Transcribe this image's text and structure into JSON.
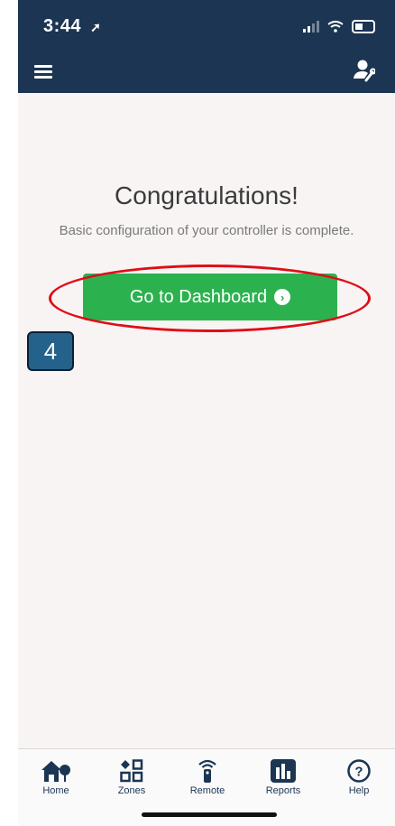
{
  "status_bar": {
    "time": "3:44"
  },
  "content": {
    "title": "Congratulations!",
    "subtitle": "Basic configuration of your controller is complete.",
    "dashboard_button": "Go to Dashboard",
    "step_badge": "4"
  },
  "tabs": [
    {
      "label": "Home",
      "icon": "home-icon"
    },
    {
      "label": "Zones",
      "icon": "zones-icon"
    },
    {
      "label": "Remote",
      "icon": "remote-icon"
    },
    {
      "label": "Reports",
      "icon": "reports-icon"
    },
    {
      "label": "Help",
      "icon": "help-icon"
    }
  ],
  "colors": {
    "header": "#1b3553",
    "button": "#2cb14f",
    "annotation": "#e00d16",
    "badge": "#25628b"
  }
}
